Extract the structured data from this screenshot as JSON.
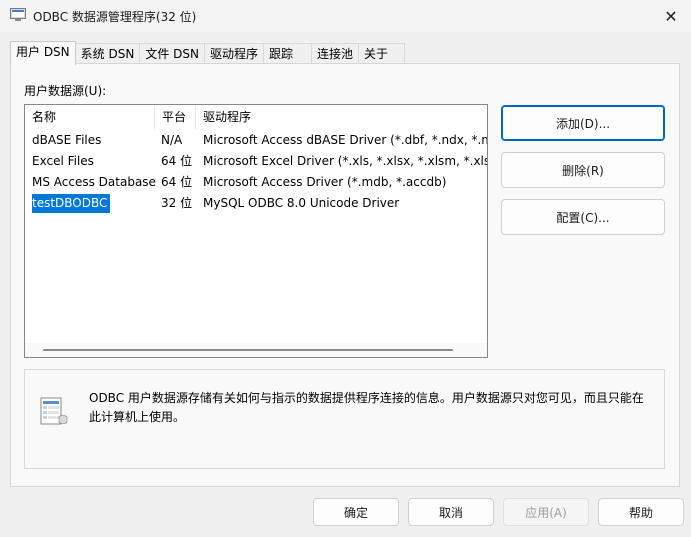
{
  "window": {
    "title": "ODBC 数据源管理程序(32 位)",
    "close_glyph": "✕"
  },
  "tabs": [
    {
      "label": "用户 DSN",
      "active": true
    },
    {
      "label": "系统 DSN"
    },
    {
      "label": "文件 DSN"
    },
    {
      "label": "驱动程序"
    },
    {
      "label": "跟踪"
    },
    {
      "label": "连接池"
    },
    {
      "label": "关于"
    }
  ],
  "user_dsn": {
    "label": "用户数据源(U):",
    "columns": [
      "名称",
      "平台",
      "驱动程序"
    ],
    "rows": [
      {
        "name": "dBASE Files",
        "platform": "N/A",
        "driver": "Microsoft Access dBASE Driver (*.dbf, *.ndx, *.mdx)"
      },
      {
        "name": "Excel Files",
        "platform": "64 位",
        "driver": "Microsoft Excel Driver (*.xls, *.xlsx, *.xlsm, *.xlsb)"
      },
      {
        "name": "MS Access Database",
        "platform": "64 位",
        "driver": "Microsoft Access Driver (*.mdb, *.accdb)"
      },
      {
        "name": "testDBODBC",
        "platform": "32 位",
        "driver": "MySQL ODBC 8.0 Unicode Driver",
        "selected": true
      }
    ]
  },
  "side_buttons": {
    "add": "添加(D)...",
    "remove": "删除(R)",
    "configure": "配置(C)..."
  },
  "info": {
    "text": "ODBC 用户数据源存储有关如何与指示的数据提供程序连接的信息。用户数据源只对您可见，而且只能在此计算机上使用。"
  },
  "footer_buttons": {
    "ok": "确定",
    "cancel": "取消",
    "apply": "应用(A)",
    "help": "帮助"
  },
  "colors": {
    "selection": "#0078d7",
    "default_button_border": "#0067c0"
  }
}
